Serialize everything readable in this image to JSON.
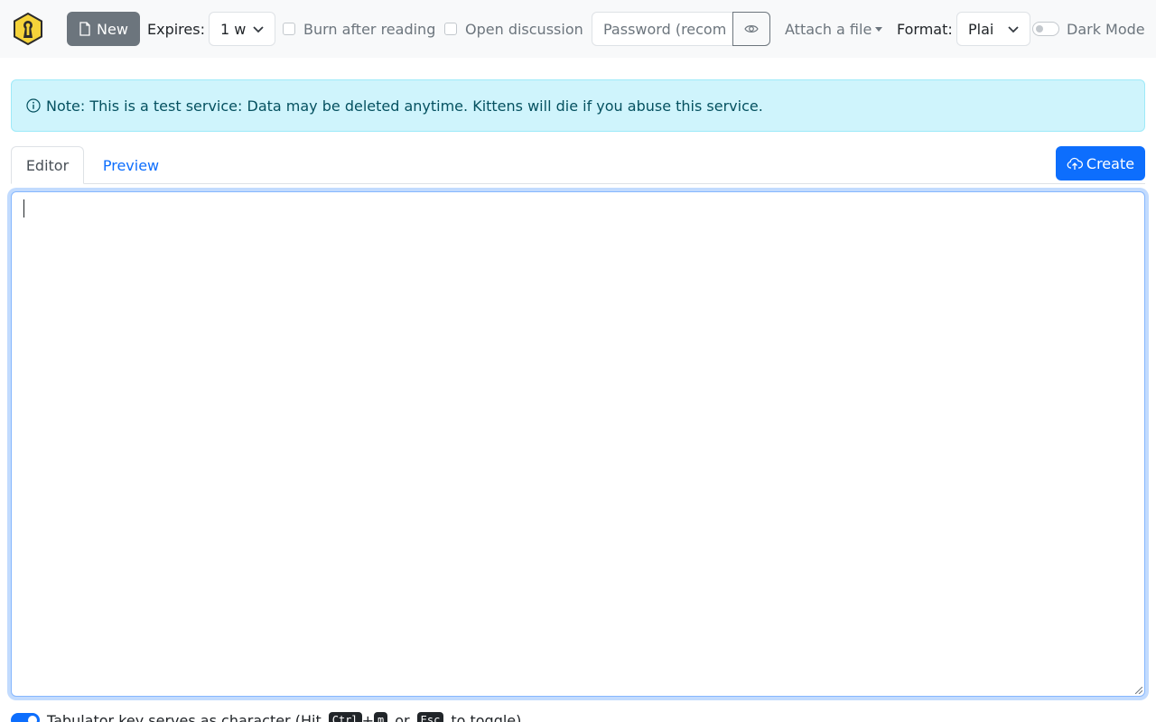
{
  "navbar": {
    "logo_icon": "keyhole-shield-icon",
    "new_button": {
      "label": "New",
      "icon": "file-icon"
    },
    "expires": {
      "label": "Expires:",
      "value": "1 w"
    },
    "burn_after_reading": {
      "label": "Burn after reading",
      "checked": false
    },
    "open_discussion": {
      "label": "Open discussion",
      "checked": false
    },
    "password": {
      "placeholder": "Password (recom",
      "toggle_icon": "eye-icon"
    },
    "attach_file": {
      "label": "Attach a file"
    },
    "format": {
      "label": "Format:",
      "value": "Plai"
    },
    "dark_mode": {
      "label": "Dark Mode",
      "enabled": false
    }
  },
  "alert": {
    "icon": "info-circle-icon",
    "text": "Note: This is a test service: Data may be deleted anytime. Kittens will die if you abuse this service."
  },
  "tabs": {
    "editor": "Editor",
    "preview": "Preview",
    "active": "Editor"
  },
  "create_button": {
    "label": "Create",
    "icon": "cloud-upload-icon"
  },
  "editor": {
    "content": ""
  },
  "tab_key_option": {
    "text_before": "Tabulator key serves as character (Hit",
    "key1": "Ctrl",
    "plus": "+",
    "key2": "m",
    "or": "or",
    "key3": "Esc",
    "text_after": "to toggle)",
    "enabled": true
  },
  "colors": {
    "primary": "#0d6efd",
    "secondary": "#6c757d",
    "alert_bg": "#cff4fc",
    "alert_text": "#055160",
    "logo_yellow": "#f5d33a"
  }
}
